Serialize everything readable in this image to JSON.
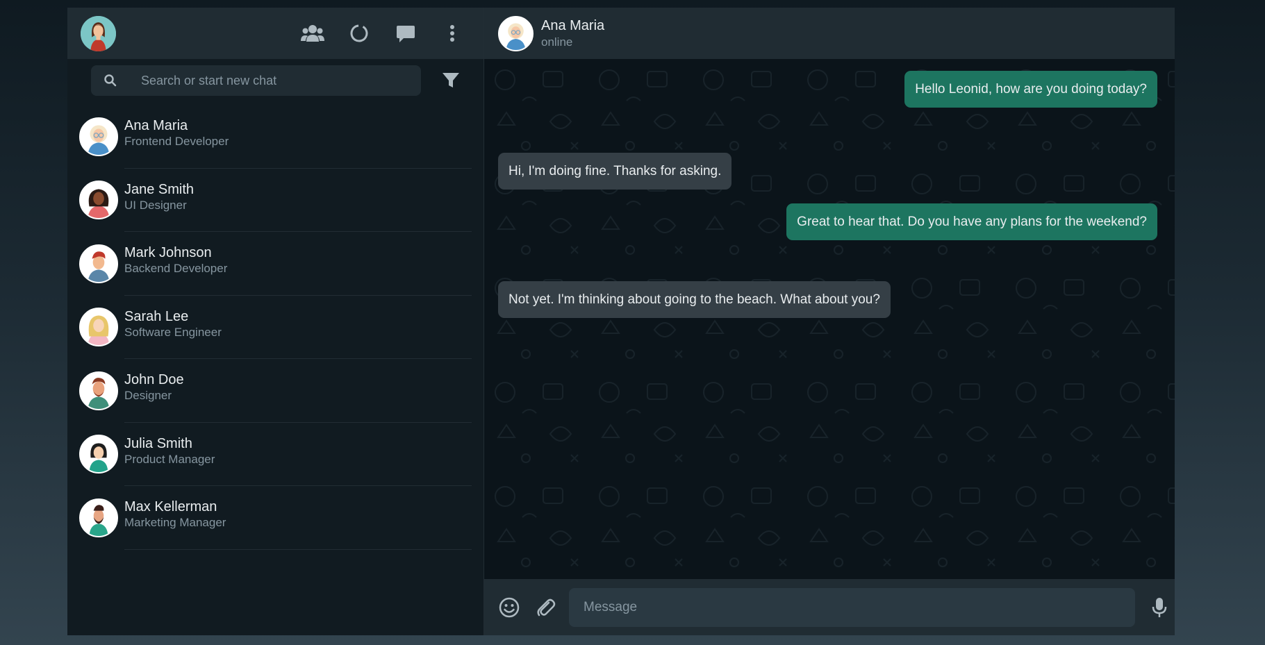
{
  "me": {
    "avatar_icon": "user-avatar-woman-red-dress"
  },
  "header_icons": [
    {
      "name": "communities-icon"
    },
    {
      "name": "status-icon"
    },
    {
      "name": "new-chat-icon"
    },
    {
      "name": "menu-icon"
    }
  ],
  "search": {
    "placeholder": "Search or start new chat"
  },
  "chats": [
    {
      "name": "Ana Maria",
      "role": "Frontend Developer"
    },
    {
      "name": "Jane Smith",
      "role": "UI Designer"
    },
    {
      "name": "Mark Johnson",
      "role": "Backend Developer"
    },
    {
      "name": "Sarah Lee",
      "role": "Software Engineer"
    },
    {
      "name": "John Doe",
      "role": "Designer"
    },
    {
      "name": "Julia Smith",
      "role": "Product Manager"
    },
    {
      "name": "Max Kellerman",
      "role": "Marketing Manager"
    }
  ],
  "conversation": {
    "contact_name": "Ana Maria",
    "contact_status": "online",
    "messages": [
      {
        "direction": "out",
        "text": "Hello Leonid, how are you doing today?"
      },
      {
        "direction": "in",
        "text": "Hi, I'm doing fine. Thanks for asking."
      },
      {
        "direction": "out",
        "text": "Great to hear that. Do you have any plans for the weekend?"
      },
      {
        "direction": "in",
        "text": "Not yet. I'm thinking about going to the beach. What about you?"
      }
    ]
  },
  "composer": {
    "placeholder": "Message"
  },
  "colors": {
    "outgoing_bubble": "#1d7560",
    "incoming_bubble": "#353f46",
    "panel_header": "#202c33",
    "background": "#111b21"
  }
}
